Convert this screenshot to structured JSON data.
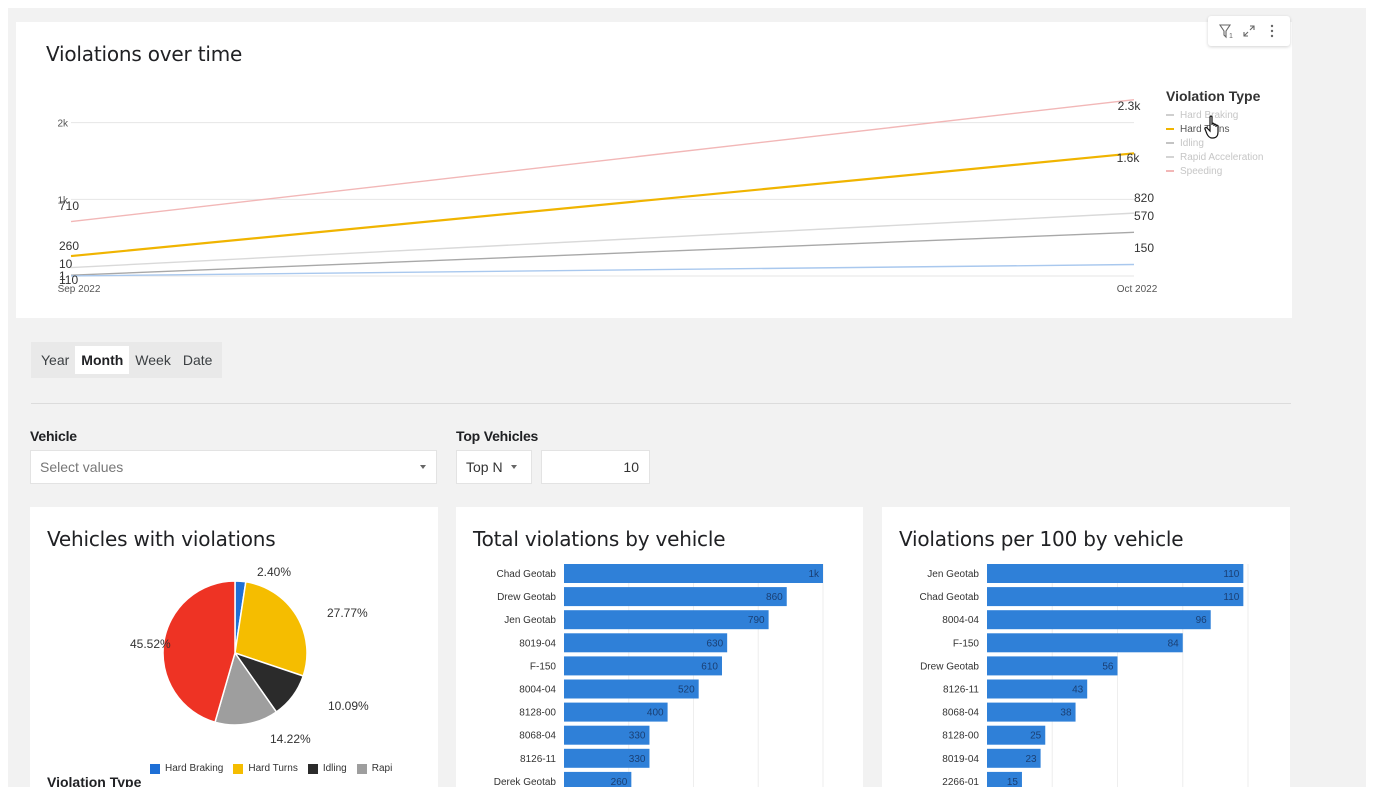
{
  "line_chart": {
    "title": "Violations over time",
    "legend_title": "Violation Type",
    "legend": [
      {
        "label": "Hard Braking",
        "color": "#cfcfcf",
        "text_color": "#c6c6c6"
      },
      {
        "label": "Hard Turns",
        "color": "#f0b400",
        "text_color": "#555555"
      },
      {
        "label": "Idling",
        "color": "#c4c4c4",
        "text_color": "#c6c6c6"
      },
      {
        "label": "Rapid Acceleration",
        "color": "#d4d4d4",
        "text_color": "#c6c6c6"
      },
      {
        "label": "Speeding",
        "color": "#f2b7b7",
        "text_color": "#c6c6c6"
      }
    ],
    "y_ticks": [
      "2k",
      "1k"
    ],
    "x_ticks": [
      "Sep 2022",
      "Oct 2022"
    ],
    "start_labels": [
      "710",
      "260",
      "10",
      "110",
      "1"
    ],
    "end_labels": [
      "2.3k",
      "1.6k",
      "820",
      "570",
      "150"
    ]
  },
  "toolbar": {
    "icons": [
      "filter-icon",
      "expand-icon",
      "more-icon"
    ],
    "filter_count": "1"
  },
  "granularity": {
    "options": [
      "Year",
      "Month",
      "Week",
      "Date"
    ],
    "selected": "Month"
  },
  "filters": {
    "vehicle_label": "Vehicle",
    "vehicle_placeholder": "Select values",
    "top_label": "Top Vehicles",
    "top_mode": "Top N",
    "top_value": "10"
  },
  "pie_card": {
    "title": "Vehicles with violations",
    "slices": [
      {
        "label": "2.40%",
        "value": 2.4,
        "color": "#1e6fd6"
      },
      {
        "label": "27.77%",
        "value": 27.77,
        "color": "#f5bd00"
      },
      {
        "label": "10.09%",
        "value": 10.09,
        "color": "#2b2b2b"
      },
      {
        "label": "14.22%",
        "value": 14.22,
        "color": "#9e9e9e"
      },
      {
        "label": "45.52%",
        "value": 45.52,
        "color": "#ee3324"
      }
    ],
    "legend": [
      {
        "label": "Hard Braking",
        "color": "#1e6fd6"
      },
      {
        "label": "Hard Turns",
        "color": "#f5bd00"
      },
      {
        "label": "Idling",
        "color": "#2b2b2b"
      },
      {
        "label": "Rapi",
        "color": "#9e9e9e"
      }
    ],
    "footer_label": "Violation Type"
  },
  "bar_card_1": {
    "title": "Total violations by vehicle"
  },
  "bar_card_2": {
    "title": "Violations per 100 by vehicle"
  },
  "chart_data": [
    {
      "type": "line",
      "title": "Violations over time",
      "x": [
        "Sep 2022",
        "Oct 2022"
      ],
      "series": [
        {
          "name": "Speeding",
          "values": [
            710,
            2300
          ],
          "color": "#f2b7b7"
        },
        {
          "name": "Hard Turns",
          "values": [
            260,
            1600
          ],
          "color": "#f0b400"
        },
        {
          "name": "Idling",
          "values": [
            110,
            820
          ],
          "color": "#d9d9d9"
        },
        {
          "name": "Rapid Acceleration",
          "values": [
            10,
            570
          ],
          "color": "#a8a8a8"
        },
        {
          "name": "Hard Braking",
          "values": [
            1,
            150
          ],
          "color": "#a9c8ee"
        }
      ],
      "yticks": [
        "2k",
        "1k"
      ],
      "grid": true,
      "legend": "right"
    },
    {
      "type": "pie",
      "title": "Vehicles with violations",
      "categories": [
        "Hard Braking",
        "Hard Turns",
        "Idling",
        "Rapid Acceleration",
        "Speeding"
      ],
      "values": [
        2.4,
        27.77,
        10.09,
        14.22,
        45.52
      ]
    },
    {
      "type": "bar",
      "title": "Total violations by vehicle",
      "categories": [
        "Chad Geotab",
        "Drew Geotab",
        "Jen Geotab",
        "8019-04",
        "F-150",
        "8004-04",
        "8128-00",
        "8068-04",
        "8126-11",
        "Derek Geotab"
      ],
      "values": [
        1000,
        860,
        790,
        630,
        610,
        520,
        400,
        330,
        330,
        260
      ],
      "labels": [
        "1k",
        "860",
        "790",
        "630",
        "610",
        "520",
        "400",
        "330",
        "330",
        "260"
      ],
      "xlim": [
        0,
        1000
      ],
      "color": "#2f80d8"
    },
    {
      "type": "bar",
      "title": "Violations per 100 by vehicle",
      "categories": [
        "Jen Geotab",
        "Chad Geotab",
        "8004-04",
        "F-150",
        "Drew Geotab",
        "8126-11",
        "8068-04",
        "8128-00",
        "8019-04",
        "2266-01"
      ],
      "values": [
        110,
        110,
        96,
        84,
        56,
        43,
        38,
        25,
        23,
        15
      ],
      "labels": [
        "110",
        "110",
        "96",
        "84",
        "56",
        "43",
        "38",
        "25",
        "23",
        "15"
      ],
      "xlim": [
        0,
        112
      ],
      "color": "#2f80d8"
    }
  ]
}
